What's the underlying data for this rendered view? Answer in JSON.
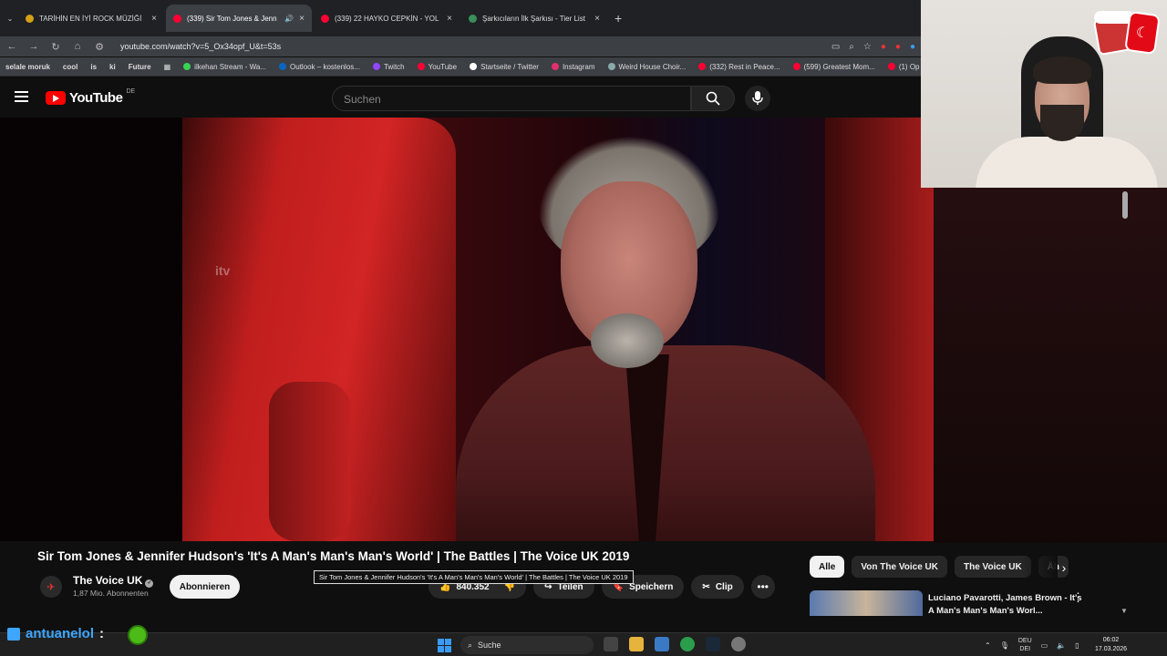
{
  "browser": {
    "tab_menu_icon": "chevron-down-icon",
    "tabs": [
      {
        "label": "TARİHİN EN İYİ ROCK MÜZİĞİ",
        "active": false
      },
      {
        "label": "(339) Sir Tom Jones & Jenn",
        "active": true,
        "audio": true
      },
      {
        "label": "(339) 22 HAYKO CEPKİN - YOL",
        "active": false
      },
      {
        "label": "Şarkıcıların İlk Şarkısı - Tier List",
        "active": false
      }
    ],
    "new_tab": "+",
    "url": "youtube.com/watch?v=5_Ox34opf_U&t=53s",
    "bookmarks": [
      {
        "label": "selale moruk",
        "bold": true
      },
      {
        "label": "cool",
        "bold": true
      },
      {
        "label": "is",
        "bold": true
      },
      {
        "label": "ki",
        "bold": true
      },
      {
        "label": "Future",
        "bold": true
      },
      {
        "label": "ilkehan Stream - Wa..."
      },
      {
        "label": "Outlook – kostenlos..."
      },
      {
        "label": "Twitch"
      },
      {
        "label": "YouTube"
      },
      {
        "label": "Startseite / Twitter"
      },
      {
        "label": "Instagram"
      },
      {
        "label": "Weird House Choir..."
      },
      {
        "label": "(332) Rest in Peace..."
      },
      {
        "label": "(599) Greatest Mom..."
      },
      {
        "label": "(1) Op"
      }
    ]
  },
  "youtube": {
    "logo_text": "YouTube",
    "country_code": "DE",
    "search_placeholder": "Suchen",
    "video": {
      "watermark": "itv",
      "title": "Sir Tom Jones & Jennifer Hudson's 'It's A Man's Man's Man's World' | The Battles | The Voice UK 2019",
      "tooltip": "Sir Tom Jones & Jennifer Hudson's 'It's A Man's Man's Man's World' | The Battles | The Voice UK 2019"
    },
    "channel": {
      "name": "The Voice UK",
      "subscribers": "1,87 Mio. Abonnenten",
      "subscribe_label": "Abonnieren"
    },
    "actions": {
      "likes": "840.352",
      "share_label": "Teilen",
      "save_label": "Speichern",
      "clip_label": "Clip",
      "more_label": "•••"
    },
    "chips": [
      "Alle",
      "Von The Voice UK",
      "The Voice UK",
      "Äh"
    ],
    "related": {
      "title": "Luciano Pavarotti, James Brown - It's A Man's Man's Man's Worl..."
    }
  },
  "stream": {
    "chat_user": "antuanelol",
    "chat_separator": ":"
  },
  "taskbar": {
    "search_label": "Suche",
    "lang_top": "DEU",
    "lang_bottom": "DEI",
    "time": "06:02",
    "date": "17.03.2026"
  }
}
